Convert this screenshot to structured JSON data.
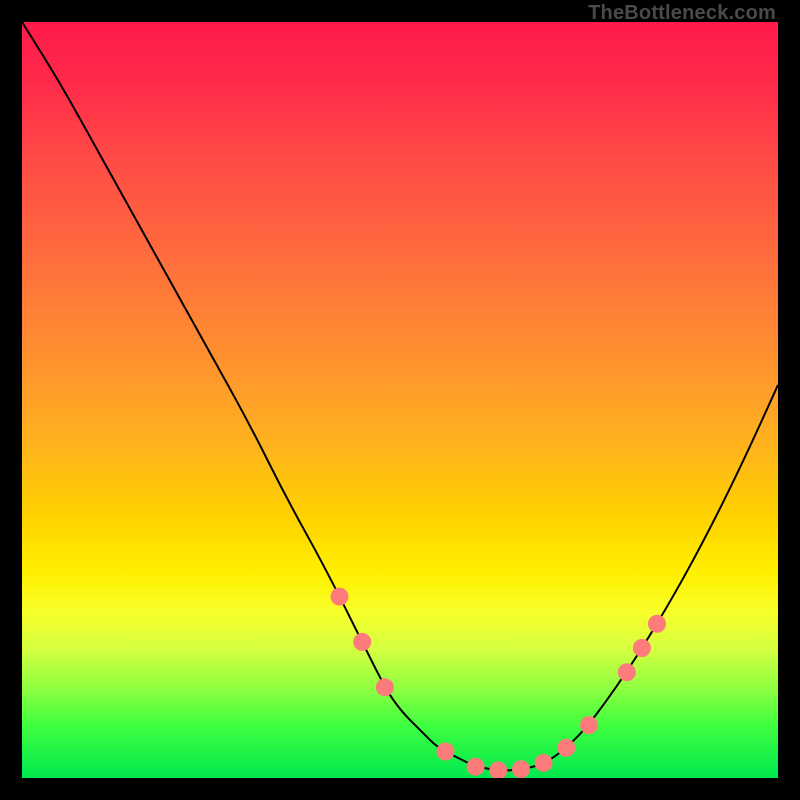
{
  "attribution": "TheBottleneck.com",
  "chart_data": {
    "type": "line",
    "title": "",
    "xlabel": "",
    "ylabel": "",
    "xlim": [
      0,
      100
    ],
    "ylim": [
      0,
      100
    ],
    "x": [
      0,
      5,
      10,
      15,
      20,
      25,
      30,
      35,
      40,
      45,
      48,
      50,
      53,
      55,
      58,
      60,
      63,
      65,
      68,
      70,
      72,
      75,
      80,
      85,
      90,
      95,
      100
    ],
    "values": [
      100,
      92,
      83,
      74,
      65,
      56,
      47,
      37,
      28,
      18,
      12,
      9,
      6,
      4,
      2.5,
      1.5,
      1,
      1,
      1.5,
      2.5,
      4,
      7,
      14,
      22,
      31,
      41,
      52
    ],
    "marker_indices_fraction": [
      0.42,
      0.45,
      0.48,
      0.56,
      0.6,
      0.63,
      0.66,
      0.69,
      0.72,
      0.75,
      0.8,
      0.82,
      0.84
    ]
  },
  "colors": {
    "curve": "#000000",
    "marker_fill": "#fd7b7b",
    "marker_stroke": "#000000"
  }
}
